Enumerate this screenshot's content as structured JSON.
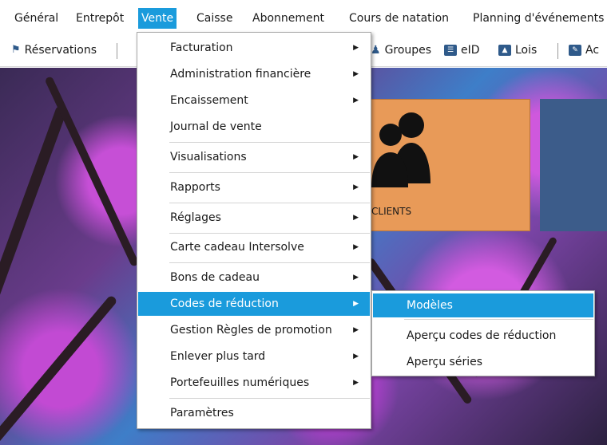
{
  "menubar": {
    "items": [
      "Général",
      "Entrepôt",
      "Vente",
      "Caisse",
      "Abonnement",
      "Cours de natation",
      "Planning d'événements"
    ]
  },
  "toolbar": {
    "reservations": "Réservations",
    "groupes": "Groupes",
    "eid": "eID",
    "lois": "Lois",
    "ac": "Ac"
  },
  "tiles": {
    "clients": "CLIENTS"
  },
  "vente_menu": {
    "items": [
      "Facturation",
      "Administration financière",
      "Encaissement",
      "Journal de vente",
      "Visualisations",
      "Rapports",
      "Réglages",
      "Carte cadeau Intersolve",
      "Bons de cadeau",
      "Codes de réduction",
      "Gestion Règles de promotion",
      "Enlever plus tard",
      "Portefeuilles numériques",
      "Paramètres"
    ]
  },
  "codes_submenu": {
    "items": [
      "Modèles",
      "Aperçu codes de réduction",
      "Aperçu séries"
    ]
  },
  "colors": {
    "highlight": "#1a9bdc",
    "tile_orange": "#e89a58",
    "tile_blue": "#3c5c8a"
  }
}
